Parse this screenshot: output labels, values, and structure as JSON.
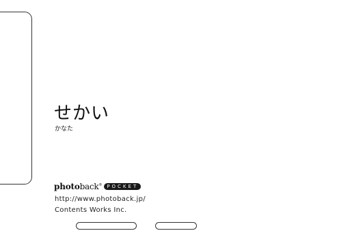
{
  "cover": {
    "title": "せかい",
    "author": "かなた"
  },
  "colophon": {
    "brand_photo": "photo",
    "brand_back": "back",
    "brand_reg": "®",
    "brand_pocket": "POCKET",
    "url": "http://www.photoback.jp/",
    "company": "Contents Works Inc."
  }
}
